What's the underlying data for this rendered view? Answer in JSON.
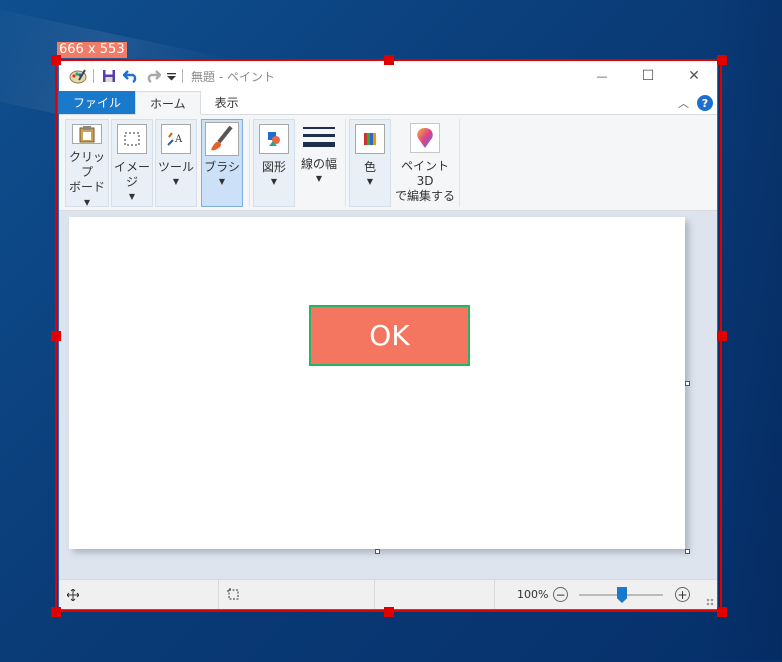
{
  "selection": {
    "size_label": "666 x 553"
  },
  "titlebar": {
    "title": "無題 - ペイント",
    "minimize_glyph": "—",
    "maximize_glyph": "☐",
    "close_glyph": "✕"
  },
  "tabs": {
    "file": "ファイル",
    "home": "ホーム",
    "view": "表示"
  },
  "ribbon": {
    "clipboard": {
      "line1": "クリップ",
      "line2": "ボード▾"
    },
    "image": {
      "label": "イメージ"
    },
    "tools": {
      "label": "ツール"
    },
    "brushes": {
      "label": "ブラシ"
    },
    "shapes": {
      "label": "図形"
    },
    "line_width": {
      "label": "線の幅"
    },
    "colors": {
      "label": "色"
    },
    "paint3d": {
      "line1": "ペイント 3D",
      "line2": "で編集する"
    }
  },
  "canvas": {
    "ok_button_label": "OK",
    "colors": {
      "ok_fill": "#f47660",
      "ok_border": "#28b463"
    }
  },
  "statusbar": {
    "zoom_level": "100%",
    "zoom_out": "−",
    "zoom_in": "+"
  },
  "theme": {
    "accent": "#1979ca",
    "selection_red": "#e00000"
  }
}
